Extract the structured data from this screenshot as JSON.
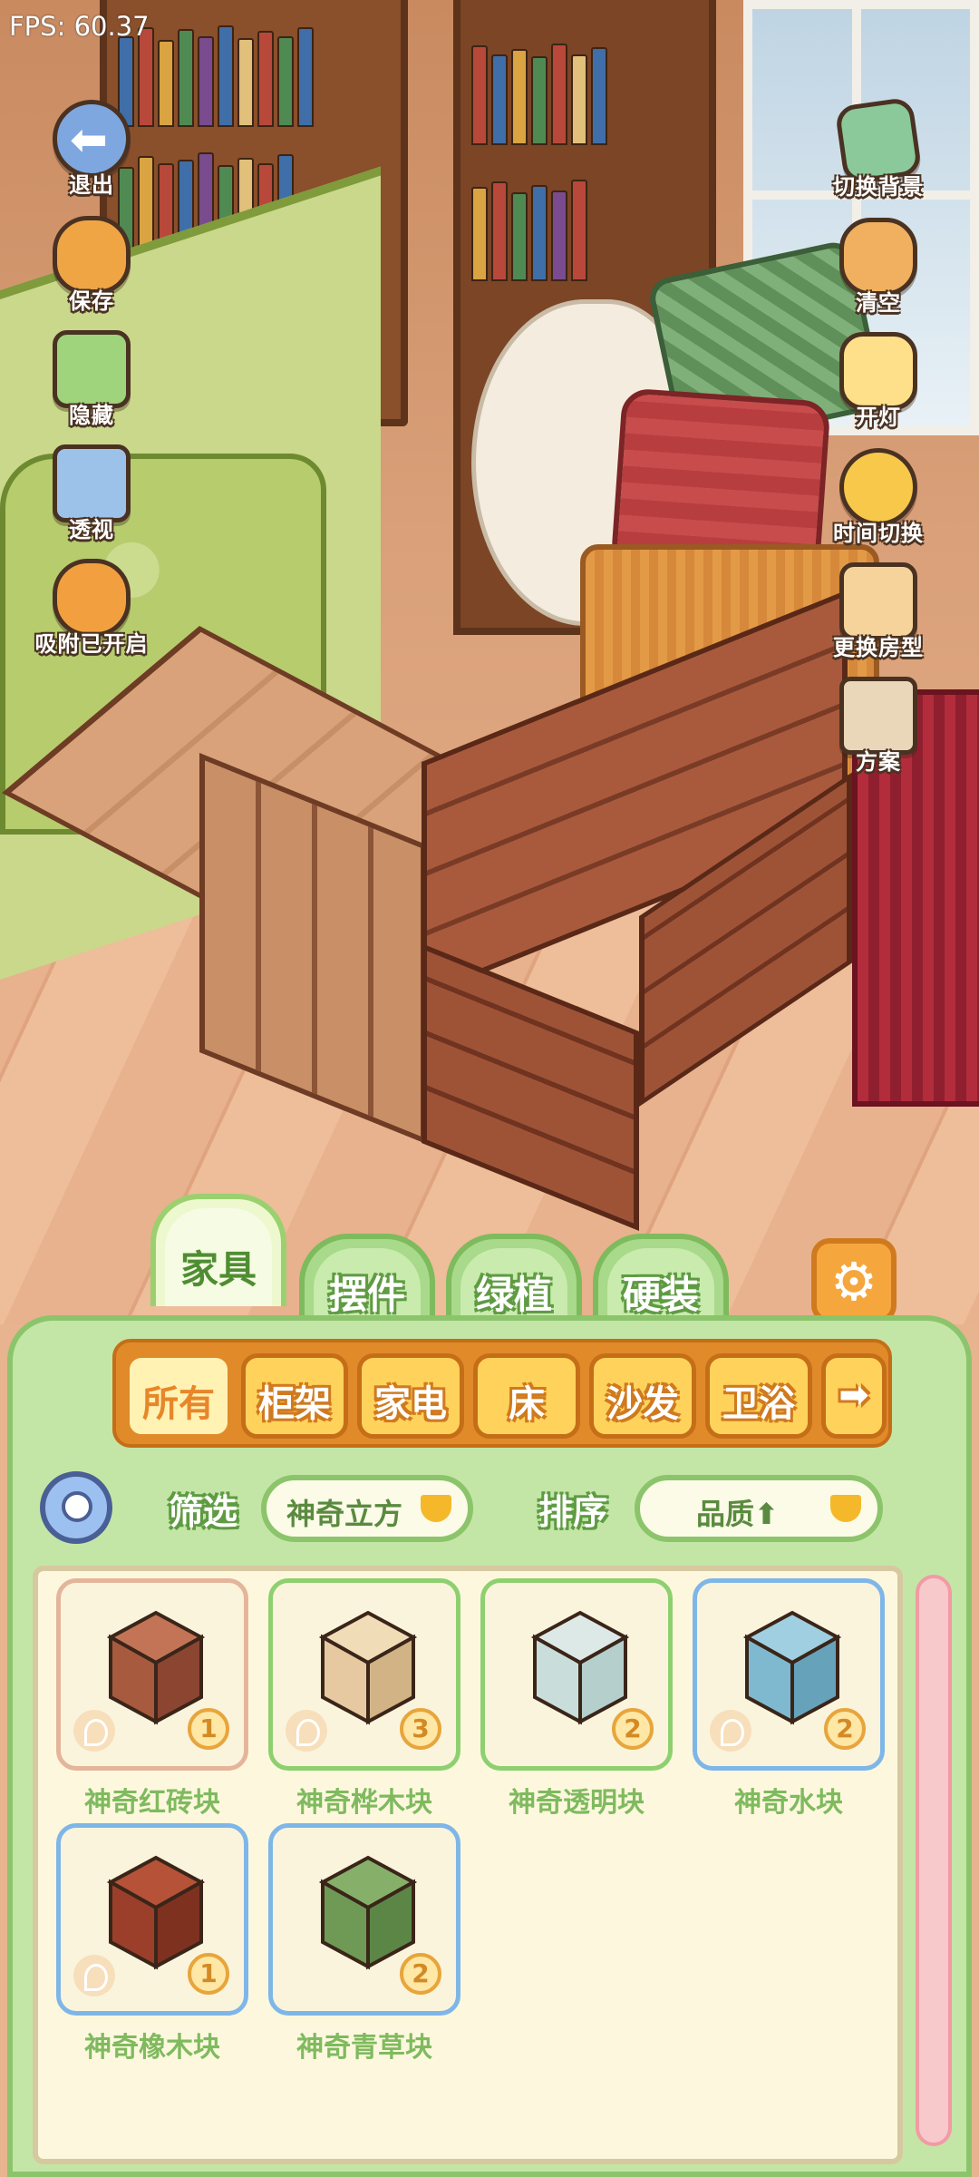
{
  "hud": {
    "fps": "FPS: 60.37"
  },
  "left_buttons": [
    {
      "label": "退出",
      "icon": "exit-arrow-icon"
    },
    {
      "label": "保存",
      "icon": "save-bird-icon"
    },
    {
      "label": "隐藏",
      "icon": "hide-puzzle-icon"
    },
    {
      "label": "透视",
      "icon": "perspective-cube-icon"
    },
    {
      "label": "吸附已开启",
      "icon": "snap-fruit-icon"
    }
  ],
  "right_buttons": [
    {
      "label": "切换背景",
      "icon": "background-flag-icon"
    },
    {
      "label": "清空",
      "icon": "clear-broom-icon"
    },
    {
      "label": "开灯",
      "icon": "lamp-icon"
    },
    {
      "label": "时间切换",
      "icon": "sun-moon-icon"
    },
    {
      "label": "更换房型",
      "icon": "house-icon"
    },
    {
      "label": "方案",
      "icon": "plan-book-icon"
    }
  ],
  "tabs": [
    {
      "label": "家具",
      "active": true
    },
    {
      "label": "摆件",
      "active": false
    },
    {
      "label": "绿植",
      "active": false
    },
    {
      "label": "硬装",
      "active": false
    }
  ],
  "categories": [
    {
      "label": "所有",
      "active": true
    },
    {
      "label": "柜架",
      "active": false
    },
    {
      "label": "家电",
      "active": false
    },
    {
      "label": "床",
      "active": false
    },
    {
      "label": "沙发",
      "active": false
    },
    {
      "label": "卫浴",
      "active": false
    },
    {
      "label": "➡",
      "active": false
    }
  ],
  "filter": {
    "label": "筛选",
    "value": "神奇立方"
  },
  "sort": {
    "label": "排序",
    "value": "品质⬆"
  },
  "items": [
    {
      "name": "神奇红砖块",
      "qty": "1",
      "border": "pink",
      "cube_color": "#a85a3f",
      "cube_top": "#c37456"
    },
    {
      "name": "神奇桦木块",
      "qty": "3",
      "border": "green",
      "cube_color": "#e6c9a1",
      "cube_top": "#f1dcb8"
    },
    {
      "name": "神奇透明块",
      "qty": "2",
      "border": "green",
      "cube_color": "#c9dedb",
      "cube_top": "#dde9e6"
    },
    {
      "name": "神奇水块",
      "qty": "2",
      "border": "blue",
      "cube_color": "#7fb9cf",
      "cube_top": "#9fcfe0"
    },
    {
      "name": "神奇橡木块",
      "qty": "1",
      "border": "blue",
      "cube_color": "#9b3f2a",
      "cube_top": "#b55238"
    },
    {
      "name": "神奇青草块",
      "qty": "2",
      "border": "blue",
      "cube_color": "#6f9a55",
      "cube_top": "#86b069"
    }
  ]
}
